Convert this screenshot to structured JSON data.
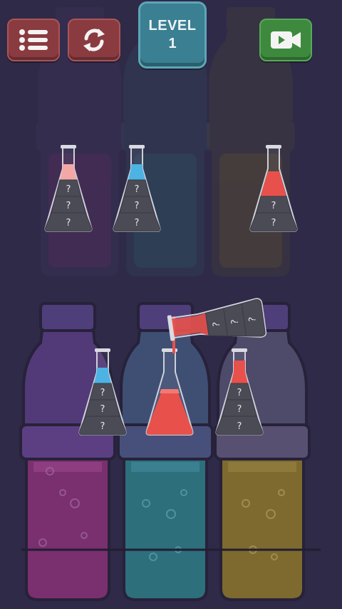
{
  "hud": {
    "menu_icon": "list-icon",
    "restart_icon": "refresh-icon",
    "video_icon": "video-camera-icon",
    "level_label": "LEVEL",
    "level_number": "1"
  },
  "colors": {
    "background": "#2e2a47",
    "button_red": "#8a3b40",
    "button_green": "#3d8a3e",
    "level_badge": "#3a7f92",
    "liquid_red": "#e8514b",
    "liquid_pink": "#f2a9a6",
    "liquid_blue": "#4cb3e4",
    "bottle_purple": "#7a2f6e",
    "bottle_teal": "#2e6f7c",
    "bottle_olive": "#7e6a2e"
  },
  "flasks": [
    {
      "id": "top-1",
      "top_liquid": "pink",
      "hidden_layers": [
        "?",
        "?",
        "?"
      ]
    },
    {
      "id": "top-2",
      "top_liquid": "blue",
      "hidden_layers": [
        "?",
        "?",
        "?"
      ]
    },
    {
      "id": "top-3",
      "top_liquid": "red",
      "hidden_layers": [
        "?",
        "?"
      ]
    },
    {
      "id": "bottom-1",
      "top_liquid": "blue",
      "hidden_layers": [
        "?",
        "?",
        "?"
      ]
    },
    {
      "id": "bottom-2",
      "top_liquid": "red",
      "hidden_layers": []
    },
    {
      "id": "bottom-3",
      "top_liquid": "red",
      "hidden_layers": [
        "?",
        "?",
        "?"
      ]
    }
  ],
  "pouring_flask": {
    "liquid": "red",
    "hidden_layers": [
      "?",
      "?",
      "?"
    ]
  }
}
